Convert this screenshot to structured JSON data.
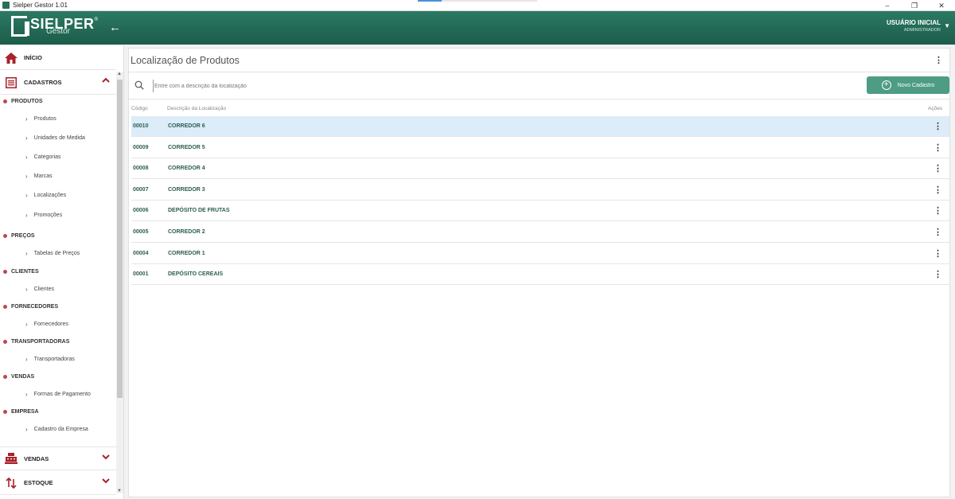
{
  "window": {
    "title": "Sielper Gestor 1.01",
    "minimize": "–",
    "restore": "❐",
    "close": "✕"
  },
  "header": {
    "logo_text": "SIELPER",
    "logo_reg": "®",
    "logo_sub": "Gestor",
    "back_icon": "arrow-left-icon",
    "user_name": "USUÁRIO INICIAL",
    "user_role": "ADMINISTRADOR"
  },
  "sidebar": {
    "inicio": "INÍCIO",
    "cadastros": "CADASTROS",
    "groups": {
      "produtos": "PRODUTOS",
      "precos": "PREÇOS",
      "clientes": "CLIENTES",
      "fornecedores": "FORNECEDORES",
      "transportadoras": "TRANSPORTADORAS",
      "vendas": "VENDAS",
      "empresa": "EMPRESA"
    },
    "items": {
      "produtos": "Produtos",
      "unidades": "Unidades de Medida",
      "categorias": "Categorias",
      "marcas": "Marcas",
      "localizacoes": "Localizações",
      "promocoes": "Promoções",
      "tabelas_precos": "Tabelas de Preços",
      "clientes": "Clientes",
      "fornecedores": "Fornecedores",
      "transportadoras": "Transportadoras",
      "formas_pagamento": "Formas de Pagamento",
      "cadastro_empresa": "Cadastro da Empresa"
    },
    "vendas": "VENDAS",
    "estoque": "ESTOQUE"
  },
  "main": {
    "title": "Localização de Produtos",
    "search_placeholder": "Entre com a descrição da localização",
    "new_button": "Novo Cadastro",
    "columns": {
      "code": "Código",
      "desc": "Descrição da Localização",
      "actions": "Ações"
    },
    "rows": [
      {
        "code": "00010",
        "desc": "CORREDOR 6"
      },
      {
        "code": "00009",
        "desc": "CORREDOR 5"
      },
      {
        "code": "00008",
        "desc": "CORREDOR 4"
      },
      {
        "code": "00007",
        "desc": "CORREDOR 3"
      },
      {
        "code": "00006",
        "desc": "DEPÓSITO DE FRUTAS"
      },
      {
        "code": "00005",
        "desc": "CORREDOR 2"
      },
      {
        "code": "00004",
        "desc": "CORREDOR 1"
      },
      {
        "code": "00001",
        "desc": "DEPÓSITO CEREAIS"
      }
    ]
  },
  "colors": {
    "brand_green": "#1f6652",
    "accent_red": "#a8232b",
    "button_green": "#4d9c83",
    "selected_row": "#dcecf8"
  }
}
